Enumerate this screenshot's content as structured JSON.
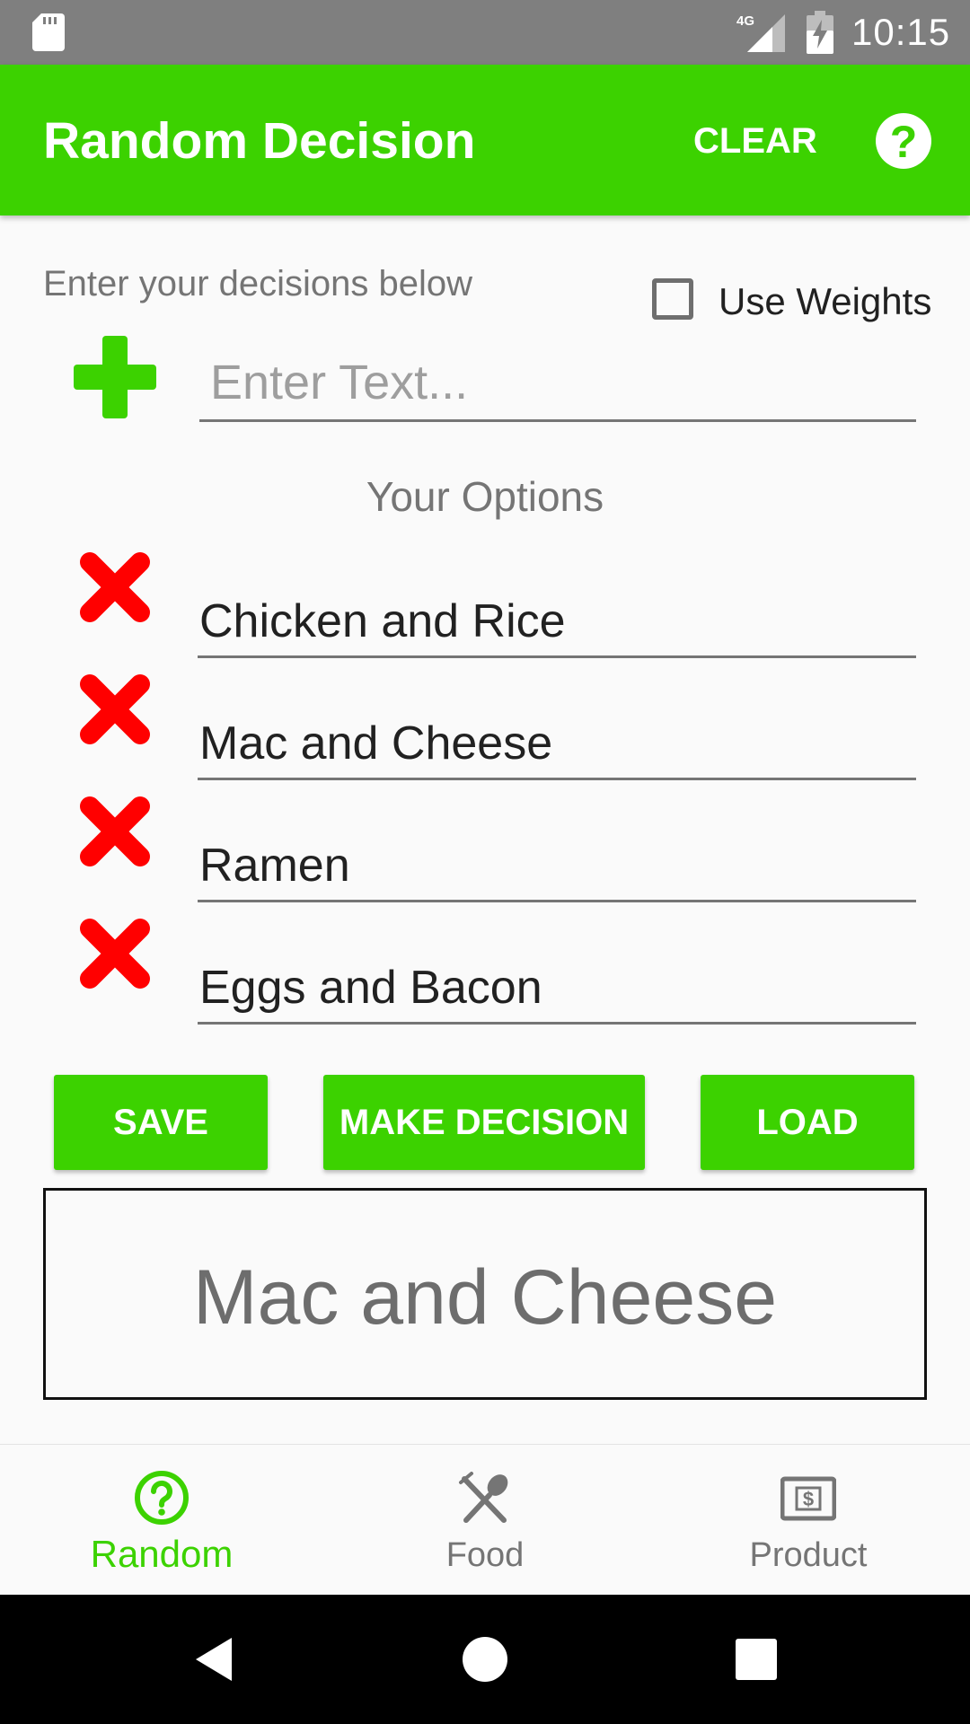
{
  "status_bar": {
    "network": "4G",
    "time": "10:15"
  },
  "app_bar": {
    "title": "Random Decision",
    "clear_label": "CLEAR",
    "help_symbol": "?",
    "accent_color": "#3cd200"
  },
  "input_section": {
    "instruction": "Enter your decisions below",
    "use_weights_label": "Use Weights",
    "use_weights_checked": false,
    "placeholder": "Enter Text...",
    "value": ""
  },
  "options": {
    "heading": "Your Options",
    "items": [
      {
        "label": "Chicken and Rice"
      },
      {
        "label": "Mac and Cheese"
      },
      {
        "label": "Ramen"
      },
      {
        "label": "Eggs and Bacon"
      }
    ]
  },
  "actions": {
    "save_label": "SAVE",
    "make_decision_label": "MAKE DECISION",
    "load_label": "LOAD"
  },
  "result": {
    "text": "Mac and Cheese"
  },
  "bottom_nav": {
    "items": [
      {
        "label": "Random",
        "icon": "help-circle-icon",
        "active": true
      },
      {
        "label": "Food",
        "icon": "utensils-icon",
        "active": false
      },
      {
        "label": "Product",
        "icon": "dollar-bill-icon",
        "active": false
      }
    ]
  },
  "system_nav": {
    "icons": [
      "back-icon",
      "home-icon",
      "recents-icon"
    ]
  }
}
